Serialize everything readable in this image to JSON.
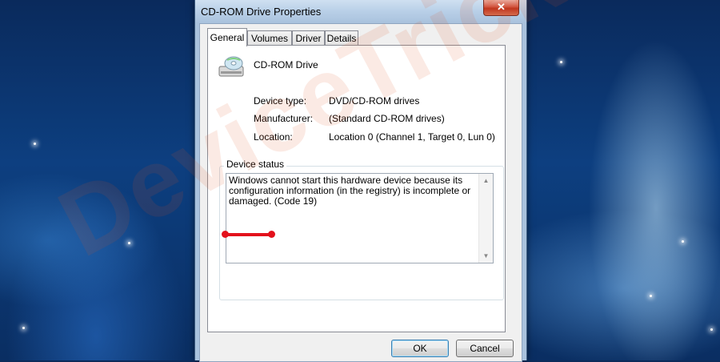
{
  "window": {
    "title": "CD-ROM Drive Properties",
    "close_label": "✕"
  },
  "tabs": [
    {
      "label": "General",
      "active": true
    },
    {
      "label": "Volumes",
      "active": false
    },
    {
      "label": "Driver",
      "active": false
    },
    {
      "label": "Details",
      "active": false
    }
  ],
  "device": {
    "name": "CD-ROM Drive",
    "icon": "cd-drive-icon"
  },
  "properties": [
    {
      "label": "Device type:",
      "value": "DVD/CD-ROM drives"
    },
    {
      "label": "Manufacturer:",
      "value": "(Standard CD-ROM drives)"
    },
    {
      "label": "Location:",
      "value": "Location 0 (Channel 1, Target 0, Lun 0)"
    }
  ],
  "device_status": {
    "label": "Device status",
    "text": "Windows cannot start this hardware device because its configuration information (in the registry) is incomplete or damaged. (Code 19)"
  },
  "buttons": {
    "ok": "OK",
    "cancel": "Cancel"
  },
  "watermark": "DeviceTricks",
  "colors": {
    "highlight": "#e3111c",
    "close_button": "#c0361e"
  }
}
